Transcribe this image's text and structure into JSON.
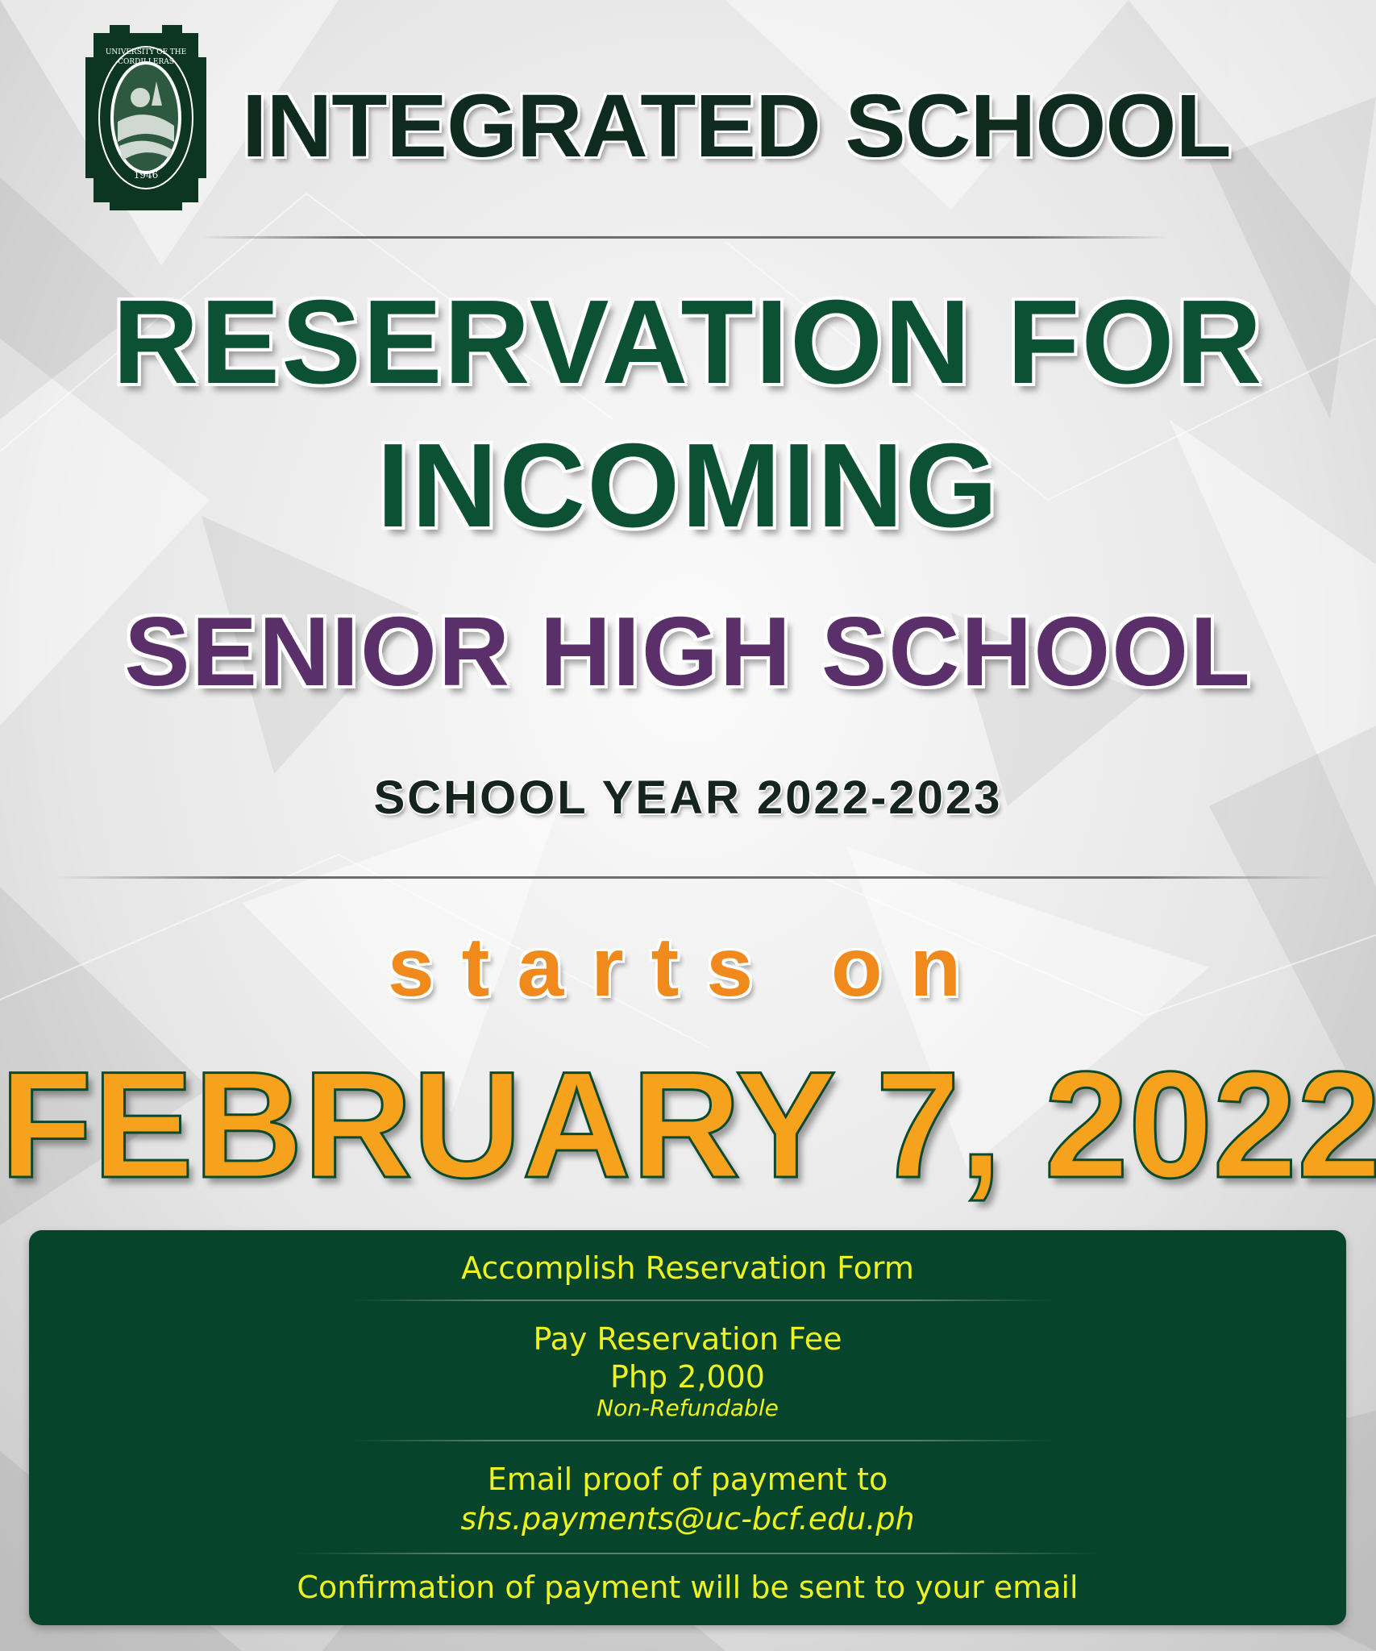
{
  "logo": {
    "ring_text": "UNIVERSITY OF THE CORDILLERAS",
    "year": "1946"
  },
  "header": {
    "title": "INTEGRATED SCHOOL"
  },
  "headline": {
    "line1": "RESERVATION FOR",
    "line2": "INCOMING",
    "line3": "SENIOR HIGH SCHOOL",
    "school_year": "SCHOOL YEAR 2022-2023"
  },
  "start": {
    "lead": "starts on",
    "date": "FEBRUARY 7, 2022"
  },
  "steps": {
    "step1": "Accomplish Reservation Form",
    "step2_title": "Pay Reservation Fee",
    "step2_amount": "Php 2,000",
    "step2_note": "Non-Refundable",
    "step3_title": "Email proof of payment to",
    "step3_email": "shs.payments@uc-bcf.edu.ph",
    "step4": "Confirmation of payment will be sent to your email"
  },
  "colors": {
    "brand_green": "#0c5134",
    "panel_green": "#06452c",
    "purple": "#5b2f6a",
    "orange": "#f08a1c",
    "gold": "#f6a21d",
    "info_yellow": "#eef21f"
  }
}
